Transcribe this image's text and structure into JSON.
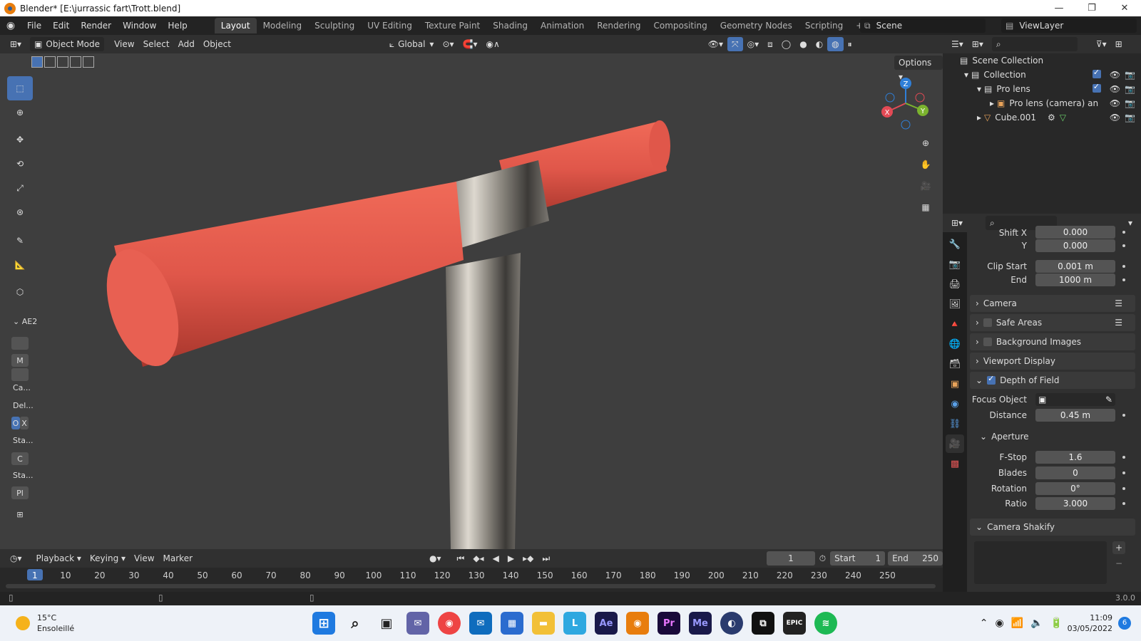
{
  "window": {
    "title": "Blender* [E:\\jurrassic fart\\Trott.blend]",
    "minimize": "—",
    "maximize": "❐",
    "close": "✕"
  },
  "menu": [
    "File",
    "Edit",
    "Render",
    "Window",
    "Help"
  ],
  "workspaces": [
    "Layout",
    "Modeling",
    "Sculpting",
    "UV Editing",
    "Texture Paint",
    "Shading",
    "Animation",
    "Rendering",
    "Compositing",
    "Geometry Nodes",
    "Scripting"
  ],
  "scene": {
    "name": "Scene",
    "view_layer": "ViewLayer"
  },
  "viewport_header": {
    "mode": "Object Mode",
    "menus": [
      "View",
      "Select",
      "Add",
      "Object"
    ],
    "orientation": "Global",
    "options": "Options"
  },
  "left_panel": {
    "title": "AE2",
    "items": [
      "M",
      "Ca...",
      "Del...",
      "O",
      "X",
      "Sta...",
      "C",
      "Sta...",
      "Pl"
    ]
  },
  "timeline": {
    "menus": [
      "Playback",
      "Keying",
      "View",
      "Marker"
    ],
    "current_frame": "1",
    "start_label": "Start",
    "start": "1",
    "end_label": "End",
    "end": "250",
    "ticks": [
      "1",
      "10",
      "20",
      "30",
      "40",
      "50",
      "60",
      "70",
      "80",
      "90",
      "100",
      "110",
      "120",
      "130",
      "140",
      "150",
      "160",
      "170",
      "180",
      "190",
      "200",
      "210",
      "220",
      "230",
      "240",
      "250"
    ]
  },
  "status": {
    "version": "3.0.0"
  },
  "outliner": {
    "rows": [
      "Scene Collection",
      "Collection",
      "Pro lens",
      "Pro lens (camera) an",
      "Cube.001"
    ]
  },
  "properties": {
    "shift_x_label": "Shift X",
    "shift_x": "0.000",
    "y_label": "Y",
    "y": "0.000",
    "clip_start_label": "Clip Start",
    "clip_start": "0.001 m",
    "clip_end_label": "End",
    "clip_end": "1000 m",
    "sections": [
      "Camera",
      "Safe Areas",
      "Background Images",
      "Viewport Display",
      "Depth of Field"
    ],
    "focus_object_label": "Focus Object",
    "distance_label": "Distance",
    "distance": "0.45 m",
    "aperture_label": "Aperture",
    "fstop_label": "F-Stop",
    "fstop": "1.6",
    "blades_label": "Blades",
    "blades": "0",
    "rotation_label": "Rotation",
    "rotation": "0°",
    "ratio_label": "Ratio",
    "ratio": "3.000",
    "shakify_label": "Camera Shakify"
  },
  "taskbar": {
    "weather_temp": "15°C",
    "weather_desc": "Ensoleillé",
    "time": "11:09",
    "date": "03/05/2022",
    "notif_count": "6",
    "apps": [
      "Ae",
      "Pr",
      "Me",
      "EPIC"
    ]
  },
  "axes": {
    "x": "X",
    "y": "Y",
    "z": "Z"
  },
  "colors": {
    "accent": "#4772b3",
    "grip": "#e0574a",
    "metal": "#b9b3a8"
  }
}
